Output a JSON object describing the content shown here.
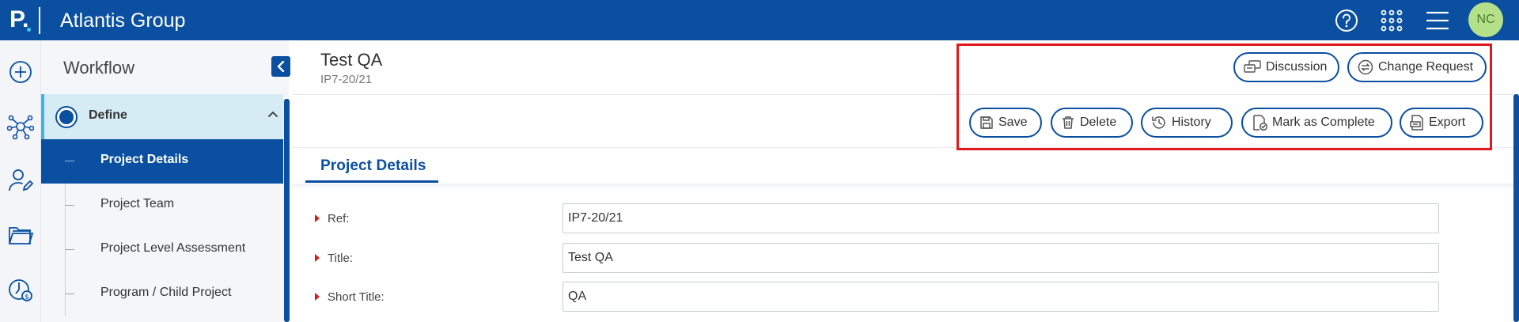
{
  "header": {
    "logo_text": "P.",
    "app_title": "Atlantis Group",
    "avatar_initials": "NC",
    "icons": [
      "help-icon",
      "apps-grid-icon",
      "menu-icon"
    ],
    "brand_color": "#0a4fa0"
  },
  "rail": {
    "icons": [
      "add-icon",
      "network-icon",
      "user-edit-icon",
      "folder-icon",
      "finance-icon"
    ]
  },
  "workflow": {
    "title": "Workflow",
    "stage": {
      "label": "Define",
      "expanded": true
    },
    "items": [
      {
        "label": "Project Details",
        "active": true
      },
      {
        "label": "Project Team",
        "active": false
      },
      {
        "label": "Project Level Assessment",
        "active": false
      },
      {
        "label": "Program / Child Project",
        "active": false
      }
    ]
  },
  "page": {
    "title": "Test QA",
    "subtitle": "IP7-20/21"
  },
  "actions": {
    "discussion": "Discussion",
    "change_request": "Change Request",
    "save": "Save",
    "delete": "Delete",
    "history": "History",
    "mark_complete": "Mark as Complete",
    "export": "Export"
  },
  "tabs": [
    {
      "label": "Project Details",
      "active": true
    }
  ],
  "form": {
    "fields": [
      {
        "label": "Ref:",
        "value": "IP7-20/21",
        "required": true
      },
      {
        "label": "Title:",
        "value": "Test QA",
        "required": true
      },
      {
        "label": "Short Title:",
        "value": "QA",
        "required": true
      }
    ]
  },
  "annotation": {
    "highlight_color": "#e0191b"
  }
}
